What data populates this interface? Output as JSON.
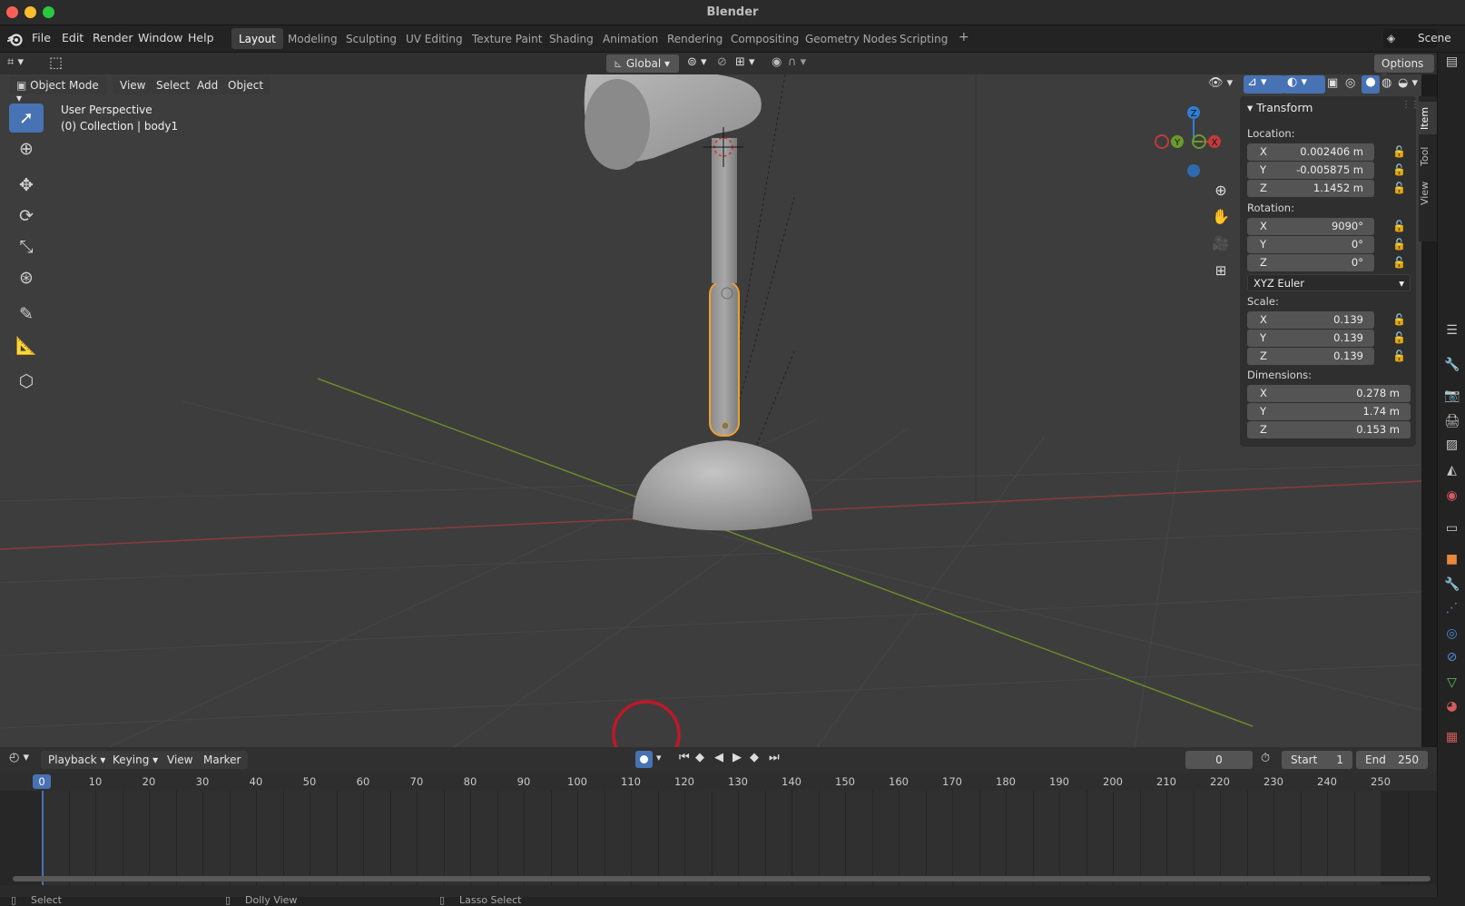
{
  "window": {
    "title": "Blender"
  },
  "menu": [
    "File",
    "Edit",
    "Render",
    "Window",
    "Help"
  ],
  "workspaces": [
    "Layout",
    "Modeling",
    "Sculpting",
    "UV Editing",
    "Texture Paint",
    "Shading",
    "Animation",
    "Rendering",
    "Compositing",
    "Geometry Nodes",
    "Scripting"
  ],
  "active_workspace": "Layout",
  "add_workspace": "+",
  "scene": "Scene",
  "header2": {
    "orientation": "Global",
    "options": "Options"
  },
  "viewport_header": {
    "mode": "Object Mode",
    "menus": [
      "View",
      "Select",
      "Add",
      "Object"
    ]
  },
  "viewport_info": {
    "perspective": "User Perspective",
    "collection": "(0) Collection | body1"
  },
  "gizmo": {
    "z": "Z",
    "y": "Y",
    "x": "X"
  },
  "npanel": {
    "section": "Transform",
    "location_label": "Location:",
    "location": [
      {
        "axis": "X",
        "value": "0.002406 m"
      },
      {
        "axis": "Y",
        "value": "-0.005875 m"
      },
      {
        "axis": "Z",
        "value": "1.1452 m"
      }
    ],
    "rotation_label": "Rotation:",
    "rotation": [
      {
        "axis": "X",
        "value": "9090°"
      },
      {
        "axis": "Y",
        "value": "0°"
      },
      {
        "axis": "Z",
        "value": "0°"
      }
    ],
    "rotation_mode": "XYZ Euler",
    "scale_label": "Scale:",
    "scale": [
      {
        "axis": "X",
        "value": "0.139"
      },
      {
        "axis": "Y",
        "value": "0.139"
      },
      {
        "axis": "Z",
        "value": "0.139"
      }
    ],
    "dimensions_label": "Dimensions:",
    "dimensions": [
      {
        "axis": "X",
        "value": "0.278 m"
      },
      {
        "axis": "Y",
        "value": "1.74 m"
      },
      {
        "axis": "Z",
        "value": "0.153 m"
      }
    ]
  },
  "sidetabs": [
    "Item",
    "Tool",
    "View"
  ],
  "timeline": {
    "menus": [
      "Playback",
      "Keying",
      "View",
      "Marker"
    ],
    "current_frame": "0",
    "start_label": "Start",
    "start": "1",
    "end_label": "End",
    "end": "250",
    "ticks": [
      "0",
      "10",
      "20",
      "30",
      "40",
      "50",
      "60",
      "70",
      "80",
      "90",
      "100",
      "110",
      "120",
      "130",
      "140",
      "150",
      "160",
      "170",
      "180",
      "190",
      "200",
      "210",
      "220",
      "230",
      "240",
      "250"
    ]
  },
  "statusbar": [
    "Select",
    "Dolly View",
    "Lasso Select"
  ],
  "colors": {
    "accent": "#4772b3",
    "selection_outline": "#f0a030",
    "annotation_circle": "#c0172b",
    "x_axis": "#9b3a3a",
    "y_axis": "#6d8a2c"
  }
}
